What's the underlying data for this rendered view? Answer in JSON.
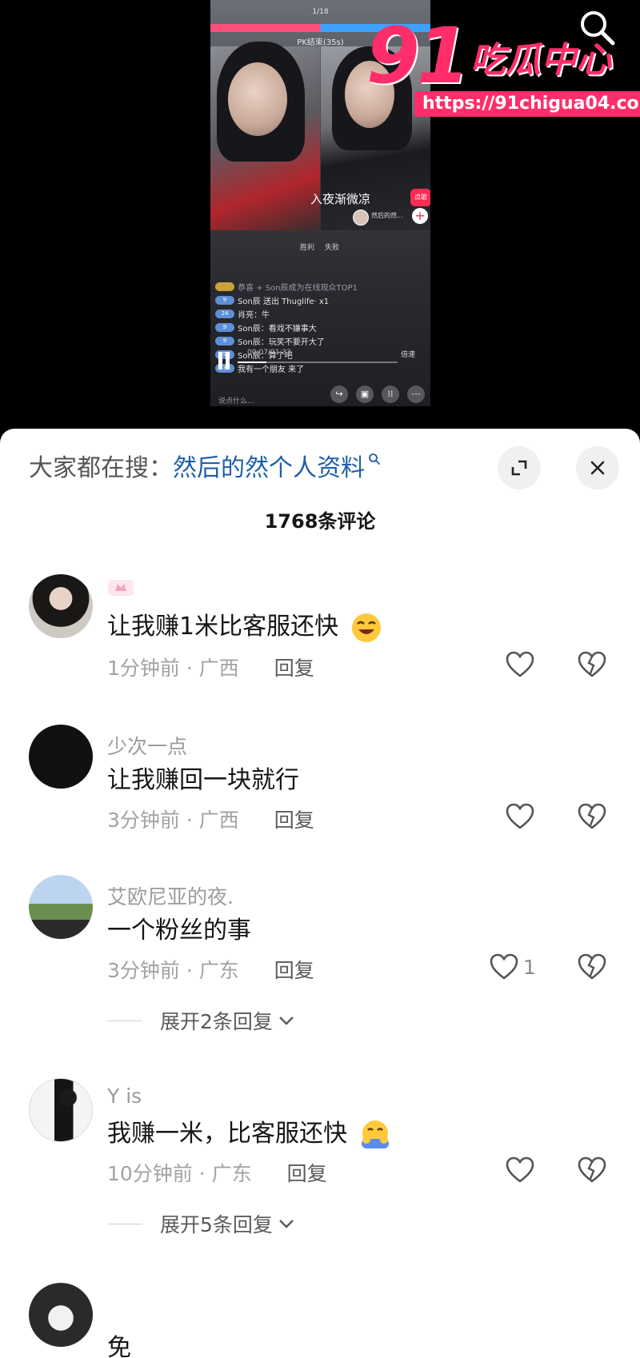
{
  "video": {
    "pk_label": "PK结束(35s)",
    "pk_count": "1/18",
    "anchor_name": "入夜渐微凉",
    "follow_label": "点歌",
    "mini_user": "然后的然...",
    "win_label": "胜利",
    "lose_label": "失败",
    "chat": [
      {
        "lv": "",
        "text": "恭喜 + Son辰成为在线观众TOP1",
        "faint": true
      },
      {
        "lv": "9",
        "text": "Son辰 送出 Thuglife· x1",
        "faint": false
      },
      {
        "lv": "24",
        "text": "肖亮：牛",
        "faint": false
      },
      {
        "lv": "9",
        "text": "Son辰：看戏不嫌事大",
        "faint": false
      },
      {
        "lv": "9",
        "text": "Son辰：玩笑不要开大了",
        "faint": false
      },
      {
        "lv": "9",
        "text": "Son辰：算了吧",
        "faint": false
      },
      {
        "lv": "3",
        "text": "我有一个朋友 来了",
        "faint": false
      }
    ],
    "time": "00:07/01:33",
    "speed": "倍速",
    "say": "说点什么..."
  },
  "watermark": {
    "big": "91",
    "name": "吃瓜中心",
    "url": "https://91chigua04.com"
  },
  "sheet": {
    "search_prefix": "大家都在搜：",
    "search_term": "然后的然个人资料",
    "comment_count": "1768条评论"
  },
  "comments": [
    {
      "name": "",
      "text": "让我赚1米比客服还快",
      "time_loc": "1分钟前 · 广西",
      "reply": "回复",
      "likes": "",
      "expand": ""
    },
    {
      "name": "少次一点",
      "text": "让我赚回一块就行",
      "time_loc": "3分钟前 · 广西",
      "reply": "回复",
      "likes": "",
      "expand": ""
    },
    {
      "name": "艾欧尼亚的夜.",
      "text": "一个粉丝的事",
      "time_loc": "3分钟前 · 广东",
      "reply": "回复",
      "likes": "1",
      "expand": "展开2条回复"
    },
    {
      "name": "Y is",
      "text": "我赚一米，比客服还快",
      "time_loc": "10分钟前 · 广东",
      "reply": "回复",
      "likes": "",
      "expand": "展开5条回复"
    },
    {
      "name": "",
      "text": "免",
      "time_loc": "",
      "reply": "",
      "likes": "",
      "expand": ""
    }
  ],
  "colors": {
    "accent_pink": "#fe2c55",
    "search_blue": "#1f5fa8",
    "watermark_pink": "#ff2d6a"
  }
}
